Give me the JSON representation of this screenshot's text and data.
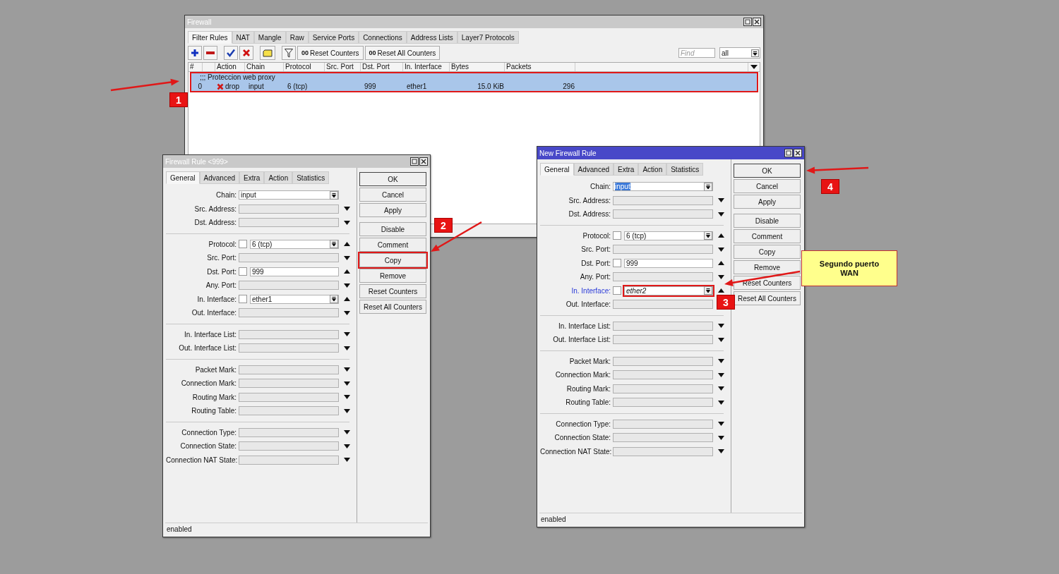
{
  "firewall_window": {
    "title": "Firewall",
    "active": false,
    "tabs": [
      {
        "label": "Filter Rules",
        "selected": true
      },
      {
        "label": "NAT",
        "selected": false
      },
      {
        "label": "Mangle",
        "selected": false
      },
      {
        "label": "Raw",
        "selected": false
      },
      {
        "label": "Service Ports",
        "selected": false
      },
      {
        "label": "Connections",
        "selected": false
      },
      {
        "label": "Address Lists",
        "selected": false
      },
      {
        "label": "Layer7 Protocols",
        "selected": false
      }
    ],
    "toolbar_buttons": [
      {
        "icon_text": "00",
        "label": "Reset Counters"
      },
      {
        "icon_text": "00",
        "label": "Reset All Counters"
      }
    ],
    "search": {
      "placeholder": "Find"
    },
    "filter": {
      "value": "all"
    },
    "columns": [
      "#",
      "Action",
      "Chain",
      "Protocol",
      "Src. Port",
      "Dst. Port",
      "In. Interface",
      "Bytes",
      "Packets"
    ],
    "rows": [
      {
        "comment": ";;; Proteccion web proxy",
        "number": "0",
        "action": "drop",
        "chain": "input",
        "protocol": "6 (tcp)",
        "dst_port": "999",
        "in_interface": "ether1",
        "bytes": "15.0 KiB",
        "packets": "296",
        "selected": true,
        "highlighted": true
      }
    ]
  },
  "rule_windows": [
    {
      "title": "Firewall Rule <999>",
      "active": false,
      "tabs": [
        {
          "label": "General",
          "selected": true
        },
        {
          "label": "Advanced",
          "selected": false
        },
        {
          "label": "Extra",
          "selected": false
        },
        {
          "label": "Action",
          "selected": false
        },
        {
          "label": "Statistics",
          "selected": false
        }
      ],
      "field_groups": [
        {
          "fields": [
            {
              "label": "Chain:",
              "value": "input",
              "kind": "combo",
              "highlighted": false
            },
            {
              "label": "Src. Address:",
              "kind": "list",
              "highlighted": false
            },
            {
              "label": "Dst. Address:",
              "kind": "list",
              "highlighted": false
            }
          ]
        },
        {
          "fields": [
            {
              "label": "Protocol:",
              "value": "6 (tcp)",
              "kind": "negate_combo",
              "checked": false,
              "highlighted": false
            },
            {
              "label": "Src. Port:",
              "kind": "list",
              "highlighted": false
            },
            {
              "label": "Dst. Port:",
              "value": "999",
              "kind": "negate",
              "checked": false,
              "highlighted": false
            },
            {
              "label": "Any. Port:",
              "kind": "list",
              "highlighted": false
            },
            {
              "label": "In. Interface:",
              "value": "ether1",
              "kind": "negate_combo",
              "checked": false,
              "highlighted": false
            },
            {
              "label": "Out. Interface:",
              "kind": "list",
              "highlighted": false
            }
          ]
        },
        {
          "fields": [
            {
              "label": "In. Interface List:",
              "kind": "list",
              "highlighted": false
            },
            {
              "label": "Out. Interface List:",
              "kind": "list",
              "highlighted": false
            }
          ]
        },
        {
          "fields": [
            {
              "label": "Packet Mark:",
              "kind": "list",
              "highlighted": false
            },
            {
              "label": "Connection Mark:",
              "kind": "list",
              "highlighted": false
            },
            {
              "label": "Routing Mark:",
              "kind": "list",
              "highlighted": false
            },
            {
              "label": "Routing Table:",
              "kind": "list",
              "highlighted": false
            }
          ]
        },
        {
          "fields": [
            {
              "label": "Connection Type:",
              "kind": "list",
              "highlighted": false
            },
            {
              "label": "Connection State:",
              "kind": "list",
              "highlighted": false
            },
            {
              "label": "Connection NAT State:",
              "kind": "list",
              "highlighted": false
            }
          ]
        }
      ],
      "buttons": [
        {
          "label": "OK",
          "highlighted": false
        },
        {
          "label": "Cancel",
          "highlighted": false
        },
        {
          "label": "Apply",
          "highlighted": false
        },
        {
          "label": "Disable",
          "highlighted": false
        },
        {
          "label": "Comment",
          "highlighted": false
        },
        {
          "label": "Copy",
          "highlighted": true
        },
        {
          "label": "Remove",
          "highlighted": false
        },
        {
          "label": "Reset Counters",
          "highlighted": false
        },
        {
          "label": "Reset All Counters",
          "highlighted": false
        }
      ],
      "status": "enabled"
    },
    {
      "title": "New Firewall Rule",
      "active": true,
      "tabs": [
        {
          "label": "General",
          "selected": true
        },
        {
          "label": "Advanced",
          "selected": false
        },
        {
          "label": "Extra",
          "selected": false
        },
        {
          "label": "Action",
          "selected": false
        },
        {
          "label": "Statistics",
          "selected": false
        }
      ],
      "field_groups": [
        {
          "fields": [
            {
              "label": "Chain:",
              "value": "input",
              "value_selected": true,
              "kind": "combo",
              "highlighted": false
            },
            {
              "label": "Src. Address:",
              "kind": "list",
              "highlighted": false
            },
            {
              "label": "Dst. Address:",
              "kind": "list",
              "highlighted": false
            }
          ]
        },
        {
          "fields": [
            {
              "label": "Protocol:",
              "value": "6 (tcp)",
              "kind": "negate_combo",
              "checked": false,
              "highlighted": false
            },
            {
              "label": "Src. Port:",
              "kind": "list",
              "highlighted": false
            },
            {
              "label": "Dst. Port:",
              "value": "999",
              "kind": "negate",
              "checked": false,
              "highlighted": false
            },
            {
              "label": "Any. Port:",
              "kind": "list",
              "highlighted": false
            },
            {
              "label": "In. Interface:",
              "value": "ether2",
              "edited": true,
              "kind": "negate_combo",
              "checked": false,
              "highlighted": true
            },
            {
              "label": "Out. Interface:",
              "kind": "list",
              "highlighted": false
            }
          ]
        },
        {
          "fields": [
            {
              "label": "In. Interface List:",
              "kind": "list",
              "highlighted": false
            },
            {
              "label": "Out. Interface List:",
              "kind": "list",
              "highlighted": false
            }
          ]
        },
        {
          "fields": [
            {
              "label": "Packet Mark:",
              "kind": "list",
              "highlighted": false
            },
            {
              "label": "Connection Mark:",
              "kind": "list",
              "highlighted": false
            },
            {
              "label": "Routing Mark:",
              "kind": "list",
              "highlighted": false
            },
            {
              "label": "Routing Table:",
              "kind": "list",
              "highlighted": false
            }
          ]
        },
        {
          "fields": [
            {
              "label": "Connection Type:",
              "kind": "list",
              "highlighted": false
            },
            {
              "label": "Connection State:",
              "kind": "list",
              "highlighted": false
            },
            {
              "label": "Connection NAT State:",
              "kind": "list",
              "highlighted": false
            }
          ]
        }
      ],
      "buttons": [
        {
          "label": "OK",
          "highlighted": false
        },
        {
          "label": "Cancel",
          "highlighted": false
        },
        {
          "label": "Apply",
          "highlighted": false
        },
        {
          "label": "Disable",
          "highlighted": false
        },
        {
          "label": "Comment",
          "highlighted": false
        },
        {
          "label": "Copy",
          "highlighted": false
        },
        {
          "label": "Remove",
          "highlighted": false
        },
        {
          "label": "Reset Counters",
          "highlighted": false
        },
        {
          "label": "Reset All Counters",
          "highlighted": false
        }
      ],
      "status": "enabled"
    }
  ],
  "annotations": {
    "badges": [
      {
        "number": "1"
      },
      {
        "number": "2"
      },
      {
        "number": "3"
      },
      {
        "number": "4"
      }
    ],
    "callout": "Segundo puerto WAN"
  }
}
